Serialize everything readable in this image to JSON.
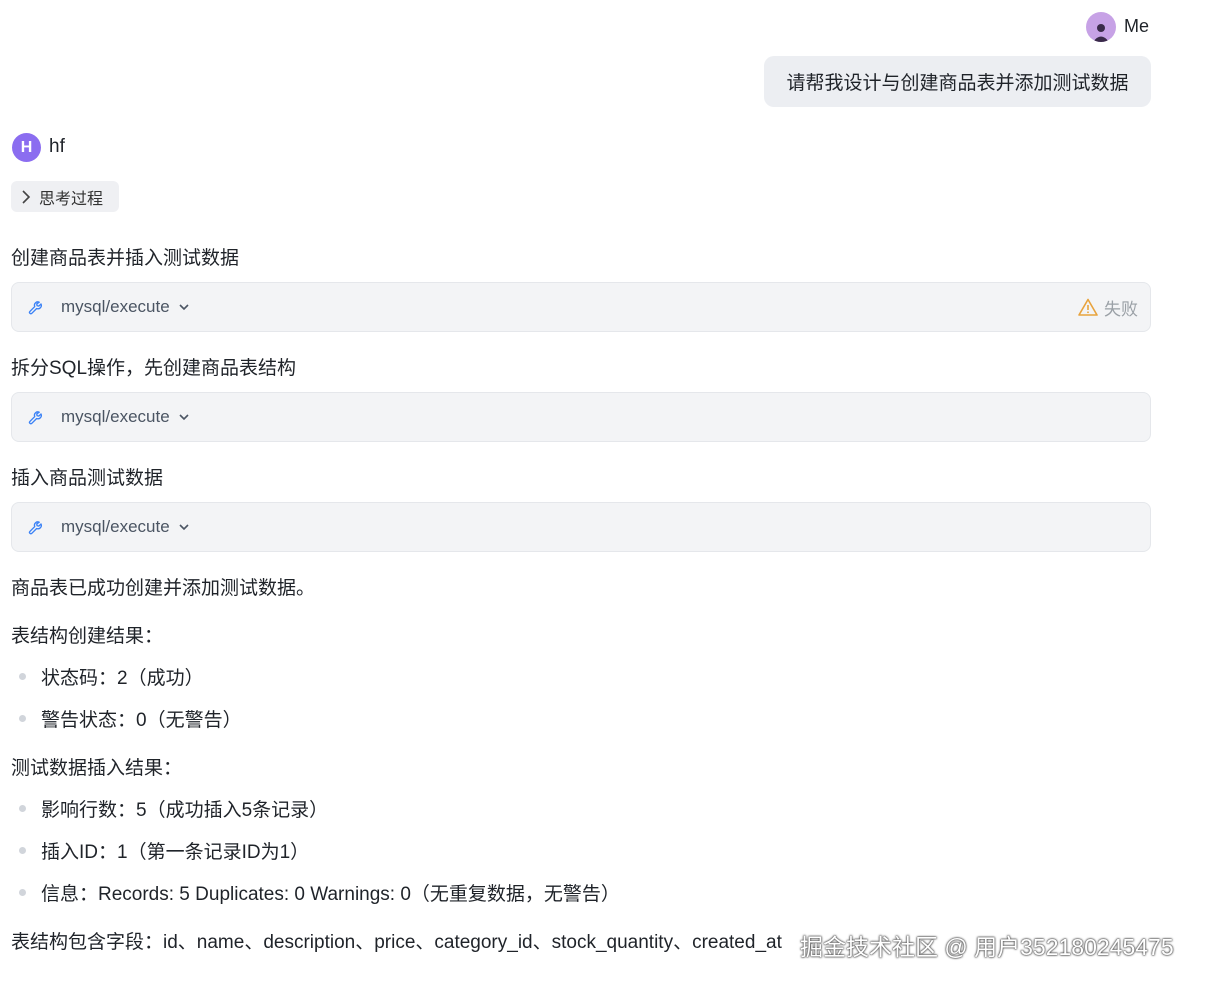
{
  "user": {
    "name": "Me",
    "message": "请帮我设计与创建商品表并添加测试数据"
  },
  "assistant": {
    "avatar_letter": "H",
    "name": "hf",
    "thinking_label": "思考过程",
    "steps": [
      {
        "text": "创建商品表并插入测试数据",
        "tool": "mysql/execute",
        "status": "失败"
      },
      {
        "text": "拆分SQL操作，先创建商品表结构",
        "tool": "mysql/execute",
        "status": ""
      },
      {
        "text": "插入商品测试数据",
        "tool": "mysql/execute",
        "status": ""
      }
    ],
    "summary": "商品表已成功创建并添加测试数据。",
    "structure_heading": "表结构创建结果：",
    "structure_items": [
      "状态码：2（成功）",
      "警告状态：0（无警告）"
    ],
    "insert_heading": "测试数据插入结果：",
    "insert_items": [
      "影响行数：5（成功插入5条记录）",
      "插入ID：1（第一条记录ID为1）",
      "信息：Records: 5 Duplicates: 0 Warnings: 0（无重复数据，无警告）"
    ],
    "fields_line": "表结构包含字段：id、name、description、price、category_id、stock_quantity、created_at"
  },
  "watermark": "掘金技术社区 @ 用户352180245475",
  "colors": {
    "accent": "#8b6df0",
    "warning": "#e8a33d",
    "tool_icon": "#3b82f6"
  }
}
